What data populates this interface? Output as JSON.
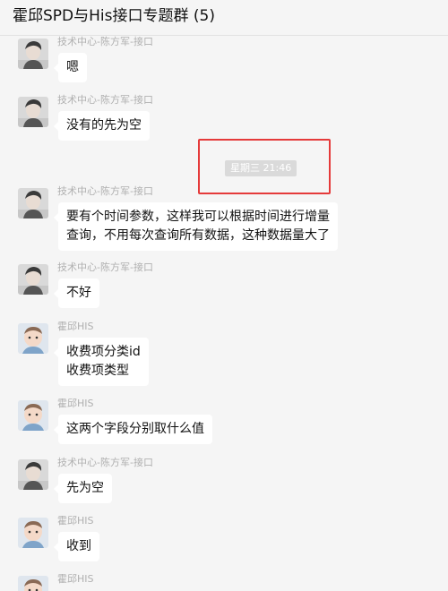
{
  "header": {
    "title": "霍邱SPD与His接口专题群 (5)"
  },
  "chat": {
    "timestamp": "星期三 21:46",
    "messages": [
      {
        "sender": "技术中心-陈方军-接口",
        "text": "嗯",
        "avatar": "person-photo-avatar"
      },
      {
        "sender": "技术中心-陈方军-接口",
        "text": "没有的先为空",
        "avatar": "person-photo-avatar"
      },
      {
        "sender": "技术中心-陈方军-接口",
        "text": "要有个时间参数，这样我可以根据时间进行增量\n查询，不用每次查询所有数据，这种数据量大了",
        "avatar": "person-photo-avatar"
      },
      {
        "sender": "技术中心-陈方军-接口",
        "text": "不好",
        "avatar": "person-photo-avatar"
      },
      {
        "sender": "霍邱HIS",
        "text": "收费项分类id\n收费项类型",
        "avatar": "baby-photo-avatar"
      },
      {
        "sender": "霍邱HIS",
        "text": "这两个字段分别取什么值",
        "avatar": "baby-photo-avatar"
      },
      {
        "sender": "技术中心-陈方军-接口",
        "text": "先为空",
        "avatar": "person-photo-avatar"
      },
      {
        "sender": "霍邱HIS",
        "text": "收到",
        "avatar": "baby-photo-avatar"
      },
      {
        "sender": "霍邱HIS",
        "text": "",
        "avatar": "baby-photo-avatar"
      }
    ]
  },
  "colors": {
    "highlight": "#e53a3a",
    "bubble": "#ffffff",
    "background": "#f5f5f5"
  }
}
